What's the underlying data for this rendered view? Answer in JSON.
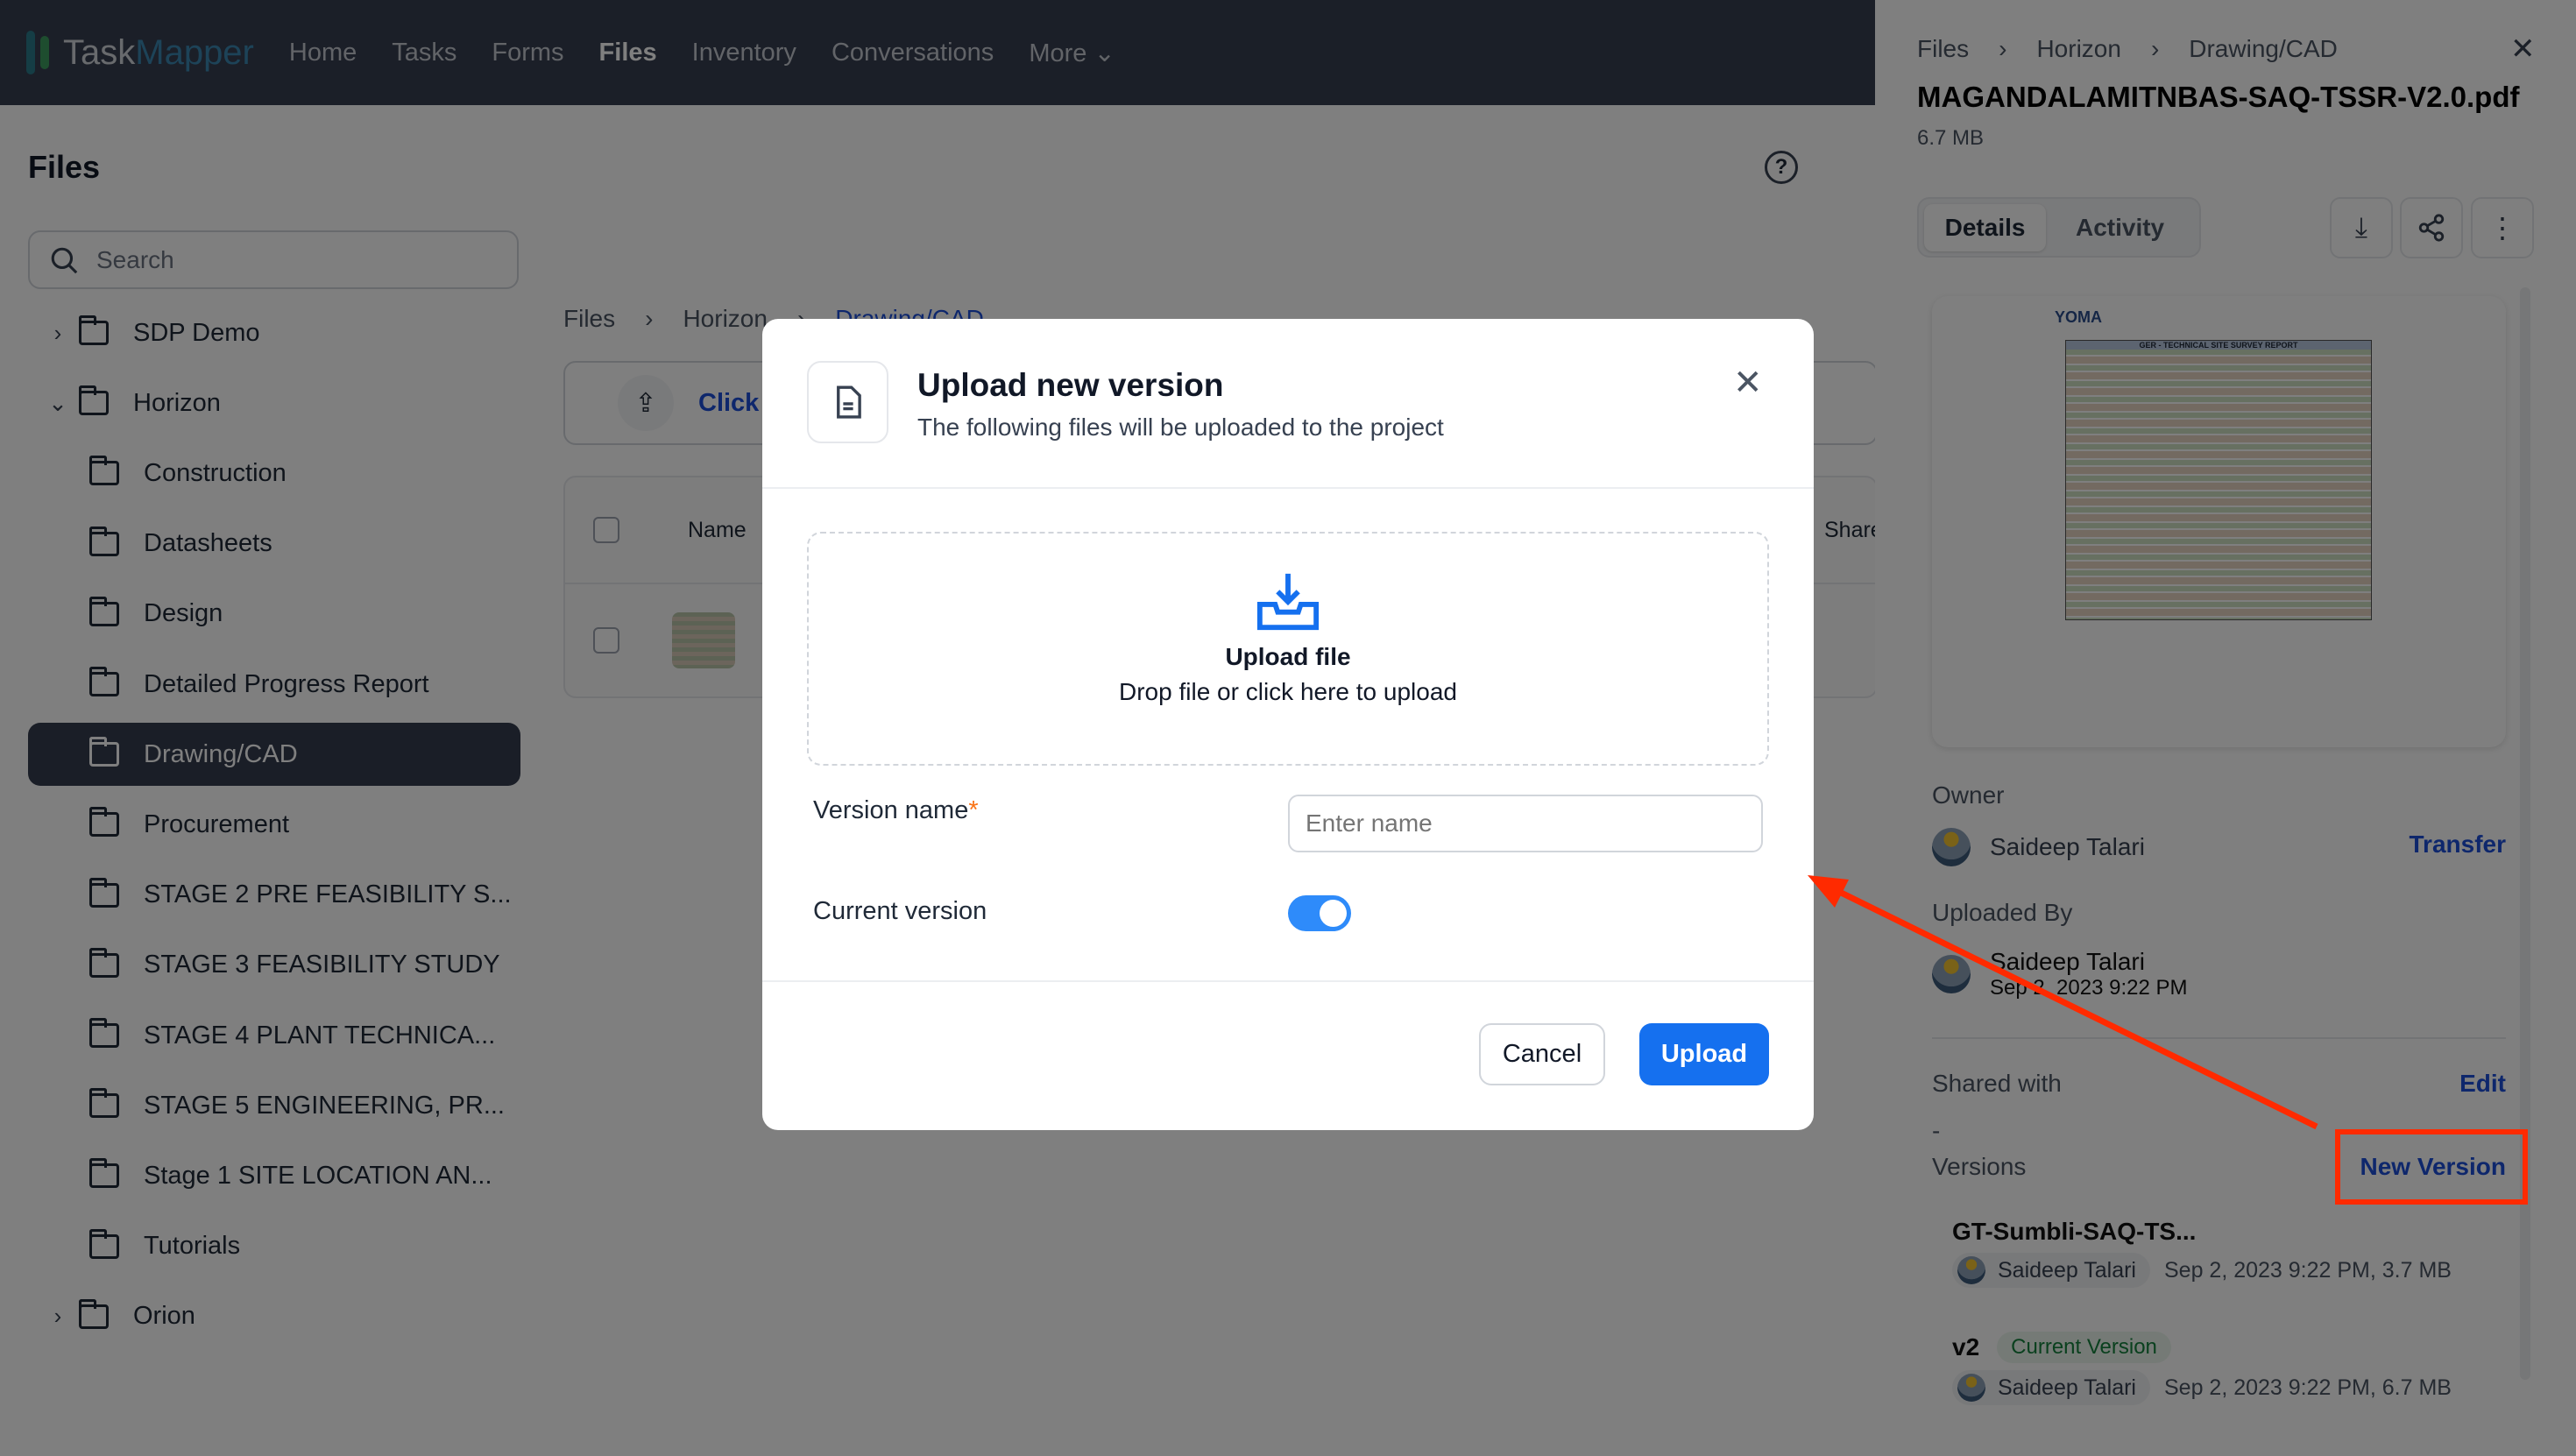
{
  "nav": {
    "brand_a": "Task",
    "brand_b": "Mapper",
    "items": [
      "Home",
      "Tasks",
      "Forms",
      "Files",
      "Inventory",
      "Conversations",
      "More"
    ],
    "active": "Files"
  },
  "sidebar": {
    "title": "Files",
    "search_placeholder": "Search",
    "items": [
      {
        "label": "SDP Demo",
        "level": 0,
        "expander": "collapsed"
      },
      {
        "label": "Horizon",
        "level": 0,
        "expander": "expanded"
      },
      {
        "label": "Construction",
        "level": 1
      },
      {
        "label": "Datasheets",
        "level": 1
      },
      {
        "label": "Design",
        "level": 1
      },
      {
        "label": "Detailed Progress Report",
        "level": 1
      },
      {
        "label": "Drawing/CAD",
        "level": 1,
        "selected": true
      },
      {
        "label": "Procurement",
        "level": 1
      },
      {
        "label": "STAGE 2 PRE FEASIBILITY S...",
        "level": 1
      },
      {
        "label": "STAGE 3 FEASIBILITY STUDY",
        "level": 1
      },
      {
        "label": "STAGE 4 PLANT TECHNICA...",
        "level": 1
      },
      {
        "label": "STAGE 5 ENGINEERING, PR...",
        "level": 1
      },
      {
        "label": "Stage 1 SITE LOCATION AN...",
        "level": 1
      },
      {
        "label": "Tutorials",
        "level": 1
      },
      {
        "label": "Orion",
        "level": 0,
        "expander": "collapsed"
      }
    ]
  },
  "main": {
    "breadcrumb": [
      "Files",
      "Horizon",
      "Drawing/CAD"
    ],
    "upload_prompt": "Click t",
    "table": {
      "col_name": "Name",
      "col_shared": "Share"
    }
  },
  "modal": {
    "title": "Upload new version",
    "subtitle": "The following files will be uploaded to the project",
    "drop_title": "Upload file",
    "drop_text": "Drop file or click here to upload",
    "version_label": "Version name",
    "required_mark": "*",
    "version_placeholder": "Enter name",
    "version_value": "",
    "current_label": "Current version",
    "current_on": true,
    "cancel": "Cancel",
    "upload": "Upload"
  },
  "panel": {
    "breadcrumb": [
      "Files",
      "Horizon",
      "Drawing/CAD"
    ],
    "filename": "MAGANDALAMITNBAS-SAQ-TSSR-V2.0.pdf",
    "size": "6.7 MB",
    "tabs": [
      "Details",
      "Activity"
    ],
    "active_tab": "Details",
    "preview": {
      "logo": "YOMA",
      "heading": "GER - TECHNICAL SITE SURVEY REPORT"
    },
    "owner_label": "Owner",
    "owner": "Saideep Talari",
    "transfer": "Transfer",
    "uploaded_label": "Uploaded By",
    "uploader": "Saideep Talari",
    "uploaded_at": "Sep 2, 2023 9:22 PM",
    "shared_label": "Shared with",
    "edit": "Edit",
    "shared_value": "-",
    "versions_label": "Versions",
    "new_version": "New Version",
    "versions": [
      {
        "name": "GT-Sumbli-SAQ-TS...",
        "badge": "",
        "user": "Saideep Talari",
        "meta": "Sep 2, 2023 9:22 PM, 3.7 MB"
      },
      {
        "name": "v2",
        "badge": "Current Version",
        "user": "Saideep Talari",
        "meta": "Sep 2, 2023 9:22 PM, 6.7 MB"
      }
    ]
  },
  "colors": {
    "accent": "#1570ef",
    "annotation": "#ff2a00",
    "badge_green": "#15803d"
  }
}
